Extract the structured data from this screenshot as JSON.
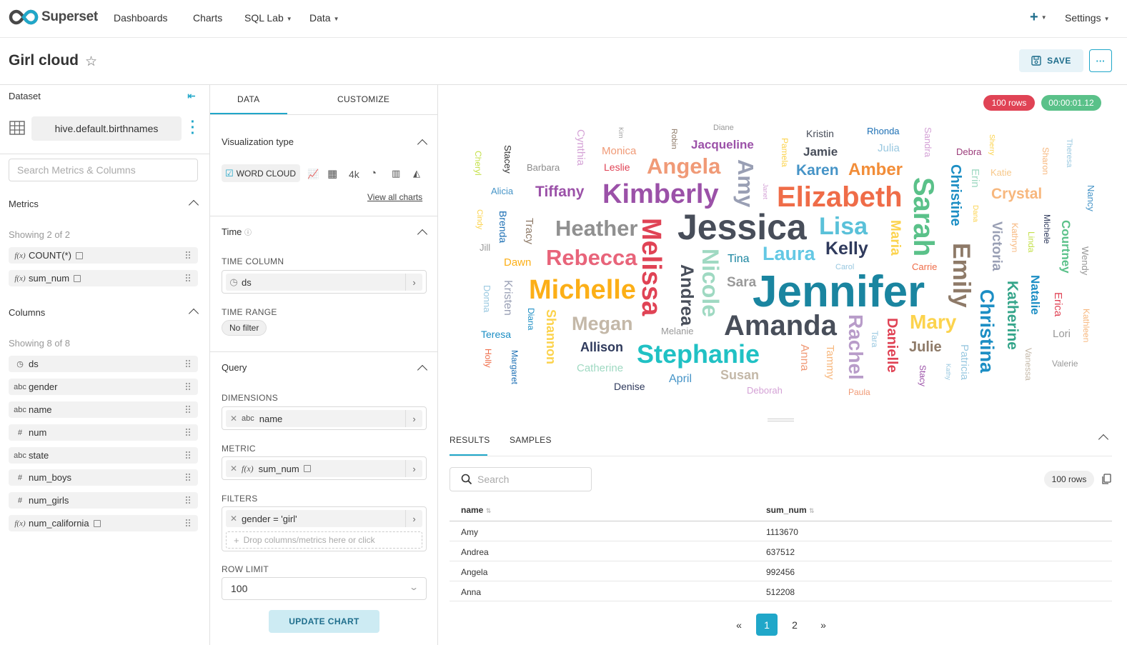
{
  "brand": {
    "name": "Superset"
  },
  "nav": {
    "dashboards": "Dashboards",
    "charts": "Charts",
    "sqllab": "SQL Lab",
    "data": "Data",
    "plus": "+",
    "settings": "Settings"
  },
  "title": {
    "text": "Girl cloud",
    "save": "SAVE",
    "more": "···"
  },
  "dataset": {
    "label": "Dataset",
    "name": "hive.default.birthnames",
    "search_placeholder": "Search Metrics & Columns"
  },
  "metrics": {
    "header": "Metrics",
    "showing": "Showing 2 of 2",
    "items": [
      {
        "icon": "f(x)",
        "name": "COUNT(*)"
      },
      {
        "icon": "f(x)",
        "name": "sum_num"
      }
    ]
  },
  "columns": {
    "header": "Columns",
    "showing": "Showing 8 of 8",
    "items": [
      {
        "icon": "clock-icon",
        "name": "ds"
      },
      {
        "icon": "abc",
        "name": "gender"
      },
      {
        "icon": "abc",
        "name": "name"
      },
      {
        "icon": "#",
        "name": "num"
      },
      {
        "icon": "abc",
        "name": "state"
      },
      {
        "icon": "#",
        "name": "num_boys"
      },
      {
        "icon": "#",
        "name": "num_girls"
      },
      {
        "icon": "f(x)",
        "name": "num_california"
      }
    ]
  },
  "tabs": {
    "data": "DATA",
    "customize": "CUSTOMIZE"
  },
  "viz": {
    "header": "Visualization type",
    "selected": "WORD CLOUD",
    "view_all": "View all charts",
    "big_number": "4k"
  },
  "time": {
    "header": "Time",
    "column_label": "TIME COLUMN",
    "column_value": "ds",
    "range_label": "TIME RANGE",
    "range_value": "No filter"
  },
  "query": {
    "header": "Query",
    "dimensions_label": "DIMENSIONS",
    "dimension_value": "name",
    "dimension_type": "abc",
    "metric_label": "METRIC",
    "metric_value": "sum_num",
    "metric_type": "f(x)",
    "filters_label": "FILTERS",
    "filter_value": "gender = 'girl'",
    "drop_placeholder": "Drop columns/metrics here or click",
    "row_limit_label": "ROW LIMIT",
    "row_limit_value": "100",
    "update_button": "UPDATE CHART"
  },
  "status": {
    "rows": "100 rows",
    "duration": "00:00:01.12",
    "row_color": "#e04355",
    "time_color": "#5ac189"
  },
  "wordcloud": [
    {
      "text": "Jennifer",
      "color": "#1a85a0",
      "size": 62
    },
    {
      "text": "Jessica",
      "color": "#484e5a",
      "size": 50
    },
    {
      "text": "Elizabeth",
      "color": "#ef6c48",
      "size": 40
    },
    {
      "text": "Amanda",
      "color": "#484e5a",
      "size": 40
    },
    {
      "text": "Michelle",
      "color": "#fcaf17",
      "size": 38
    },
    {
      "text": "Kimberly",
      "color": "#9b51a8",
      "size": 38
    },
    {
      "text": "Melissa",
      "color": "#e04355",
      "size": 38
    },
    {
      "text": "Sarah",
      "color": "#5ac189",
      "size": 40
    },
    {
      "text": "Stephanie",
      "color": "#20c1c4",
      "size": 36
    },
    {
      "text": "Lisa",
      "color": "#5ac1d9",
      "size": 34
    },
    {
      "text": "Heather",
      "color": "#909090",
      "size": 31
    },
    {
      "text": "Rebecca",
      "color": "#e8647a",
      "size": 31
    },
    {
      "text": "Angela",
      "color": "#f09a77",
      "size": 31
    },
    {
      "text": "Emily",
      "color": "#8e7a68",
      "size": 34
    },
    {
      "text": "Nicole",
      "color": "#9fd9c2",
      "size": 32
    },
    {
      "text": "Christina",
      "color": "#1c8ec4",
      "size": 27
    },
    {
      "text": "Amy",
      "color": "#999fb4",
      "size": 31
    },
    {
      "text": "Laura",
      "color": "#64c8e4",
      "size": 27
    },
    {
      "text": "Megan",
      "color": "#c4b8a8",
      "size": 27
    },
    {
      "text": "Mary",
      "color": "#fcd34d",
      "size": 28
    },
    {
      "text": "Rachel",
      "color": "#b89cc9",
      "size": 28
    },
    {
      "text": "Andrea",
      "color": "#484e5a",
      "size": 25
    },
    {
      "text": "Kelly",
      "color": "#2f3a5c",
      "size": 25
    },
    {
      "text": "Amber",
      "color": "#f28d38",
      "size": 24
    },
    {
      "text": "Crystal",
      "color": "#f7b77d",
      "size": 21
    },
    {
      "text": "Tiffany",
      "color": "#9b51a8",
      "size": 21
    },
    {
      "text": "Karen",
      "color": "#4694c7",
      "size": 21
    },
    {
      "text": "Katherine",
      "color": "#35a58a",
      "size": 21
    },
    {
      "text": "Julie",
      "color": "#8e7a68",
      "size": 20
    },
    {
      "text": "Danielle",
      "color": "#e04355",
      "size": 20
    },
    {
      "text": "Christine",
      "color": "#1c8ec4",
      "size": 20
    },
    {
      "text": "Jacqueline",
      "color": "#9b51a8",
      "size": 17
    },
    {
      "text": "Victoria",
      "color": "#999fb4",
      "size": 19
    },
    {
      "text": "Courtney",
      "color": "#5ac189",
      "size": 17
    },
    {
      "text": "Natalie",
      "color": "#1c8ec4",
      "size": 17
    },
    {
      "text": "Maria",
      "color": "#fcd34d",
      "size": 19
    },
    {
      "text": "Jamie",
      "color": "#484e5a",
      "size": 17
    },
    {
      "text": "Sara",
      "color": "#999999",
      "size": 19
    },
    {
      "text": "Allison",
      "color": "#2f3a5c",
      "size": 18
    },
    {
      "text": "Susan",
      "color": "#c4b8a8",
      "size": 18
    },
    {
      "text": "Tina",
      "color": "#1a85a0",
      "size": 16
    },
    {
      "text": "Shannon",
      "color": "#fcd34d",
      "size": 18
    },
    {
      "text": "Kristen",
      "color": "#999fb4",
      "size": 16
    },
    {
      "text": "Brenda",
      "color": "#1c6fb4",
      "size": 14
    },
    {
      "text": "Tracy",
      "color": "#8e7a68",
      "size": 15
    },
    {
      "text": "Dawn",
      "color": "#fcaf17",
      "size": 15
    },
    {
      "text": "Patricia",
      "color": "#99c8e0",
      "size": 15
    },
    {
      "text": "Anna",
      "color": "#f09a77",
      "size": 16
    },
    {
      "text": "Tammy",
      "color": "#f7b77d",
      "size": 15
    },
    {
      "text": "Monica",
      "color": "#f09a77",
      "size": 15
    },
    {
      "text": "Leslie",
      "color": "#e04355",
      "size": 14
    },
    {
      "text": "Cynthia",
      "color": "#d4a2d6",
      "size": 15
    },
    {
      "text": "Stacey",
      "color": "#333333",
      "size": 13
    },
    {
      "text": "Barbara",
      "color": "#8c8c8c",
      "size": 13
    },
    {
      "text": "Kristin",
      "color": "#484e5a",
      "size": 14
    },
    {
      "text": "Rhonda",
      "color": "#1c6fb4",
      "size": 13
    },
    {
      "text": "Julia",
      "color": "#99c8e0",
      "size": 15
    },
    {
      "text": "Debra",
      "color": "#9b3c7a",
      "size": 13
    },
    {
      "text": "Katie",
      "color": "#f7c88a",
      "size": 13
    },
    {
      "text": "Erin",
      "color": "#9fd9c2",
      "size": 15
    },
    {
      "text": "Sandra",
      "color": "#d4a2d6",
      "size": 13
    },
    {
      "text": "Teresa",
      "color": "#1c8ec4",
      "size": 14
    },
    {
      "text": "Diana",
      "color": "#1c8ec4",
      "size": 12
    },
    {
      "text": "Melanie",
      "color": "#999999",
      "size": 13
    },
    {
      "text": "Catherine",
      "color": "#9fd9c2",
      "size": 15
    },
    {
      "text": "April",
      "color": "#4694c7",
      "size": 16
    },
    {
      "text": "Denise",
      "color": "#2f3a5c",
      "size": 14
    },
    {
      "text": "Deborah",
      "color": "#d4a2d6",
      "size": 13
    },
    {
      "text": "Paula",
      "color": "#f09a77",
      "size": 12
    },
    {
      "text": "Carrie",
      "color": "#ef6c48",
      "size": 13
    },
    {
      "text": "Carol",
      "color": "#99c8e0",
      "size": 11
    },
    {
      "text": "Lori",
      "color": "#999999",
      "size": 15
    },
    {
      "text": "Valerie",
      "color": "#999999",
      "size": 12
    },
    {
      "text": "Erica",
      "color": "#e04355",
      "size": 15
    },
    {
      "text": "Kathleen",
      "color": "#f7b77d",
      "size": 12
    },
    {
      "text": "Wendy",
      "color": "#999999",
      "size": 13
    },
    {
      "text": "Nancy",
      "color": "#4694c7",
      "size": 13
    },
    {
      "text": "Michele",
      "color": "#2f3a5c",
      "size": 12
    },
    {
      "text": "Linda",
      "color": "#c4e04a",
      "size": 12
    },
    {
      "text": "Kathryn",
      "color": "#f7b77d",
      "size": 12
    },
    {
      "text": "Alicia",
      "color": "#4694c7",
      "size": 13
    },
    {
      "text": "Jill",
      "color": "#999999",
      "size": 13
    },
    {
      "text": "Cindy",
      "color": "#fcd34d",
      "size": 11
    },
    {
      "text": "Donna",
      "color": "#99c8e0",
      "size": 13
    },
    {
      "text": "Holly",
      "color": "#ef6c48",
      "size": 12
    },
    {
      "text": "Margaret",
      "color": "#1c6fb4",
      "size": 12
    },
    {
      "text": "Cheryl",
      "color": "#c4e04a",
      "size": 12
    },
    {
      "text": "Kim",
      "color": "#a0a0a0",
      "size": 9
    },
    {
      "text": "Robin",
      "color": "#8e7a68",
      "size": 11
    },
    {
      "text": "Diane",
      "color": "#999999",
      "size": 11
    },
    {
      "text": "Pamela",
      "color": "#fcd34d",
      "size": 12
    },
    {
      "text": "Janet",
      "color": "#d4a2d6",
      "size": 9
    },
    {
      "text": "Sherry",
      "color": "#fcd34d",
      "size": 10
    },
    {
      "text": "Sharon",
      "color": "#f7b77d",
      "size": 12
    },
    {
      "text": "Theresa",
      "color": "#99c8e0",
      "size": 11
    },
    {
      "text": "Dana",
      "color": "#fcd34d",
      "size": 10
    },
    {
      "text": "Tara",
      "color": "#99c8e0",
      "size": 12
    },
    {
      "text": "Stacy",
      "color": "#9b51a8",
      "size": 12
    },
    {
      "text": "Kathy",
      "color": "#99c8e0",
      "size": 9
    },
    {
      "text": "Vanessa",
      "color": "#c4b8a8",
      "size": 12
    }
  ],
  "results": {
    "tab_results": "RESULTS",
    "tab_samples": "SAMPLES",
    "search_placeholder": "Search",
    "rows": "100 rows",
    "col_name": "name",
    "col_sum": "sum_num",
    "rows_data": [
      {
        "name": "Amy",
        "sum_num": "1113670"
      },
      {
        "name": "Andrea",
        "sum_num": "637512"
      },
      {
        "name": "Angela",
        "sum_num": "992456"
      },
      {
        "name": "Anna",
        "sum_num": "512208"
      }
    ]
  },
  "pagination": {
    "prev": "«",
    "p1": "1",
    "p2": "2",
    "next": "»"
  }
}
